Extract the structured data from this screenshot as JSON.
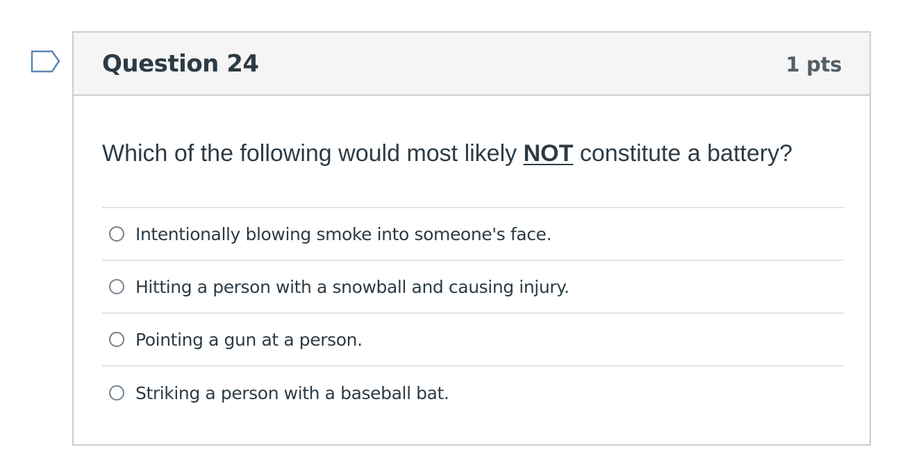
{
  "flag": {
    "icon": "flag-outline-icon",
    "color": "#5b87b3"
  },
  "question": {
    "title": "Question 24",
    "points": "1 pts",
    "text_before": "Which of the following would most likely ",
    "text_emphasis": "NOT",
    "text_after": " constitute a battery?",
    "answers": [
      {
        "label": "Intentionally blowing smoke into someone's face.",
        "selected": false
      },
      {
        "label": "Hitting a person with a snowball and causing injury.",
        "selected": false
      },
      {
        "label": "Pointing a gun at a person.",
        "selected": false
      },
      {
        "label": "Striking a person with a baseball bat.",
        "selected": false
      }
    ]
  },
  "colors": {
    "header_bg": "#f5f5f5",
    "border": "#c7cdd1",
    "text": "#2d3b45",
    "points_text": "#535e66",
    "divider": "#dfe3e6"
  }
}
